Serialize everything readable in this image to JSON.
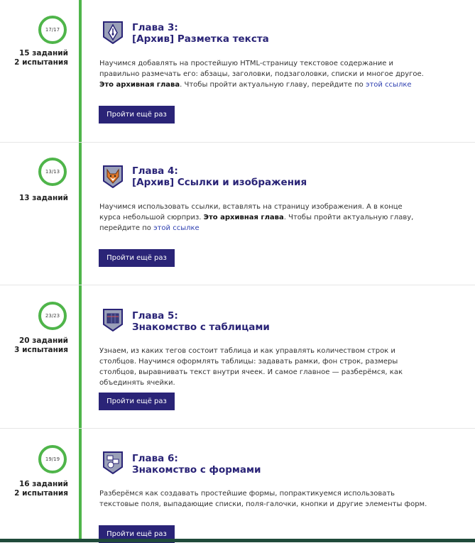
{
  "chapters": [
    {
      "progress": "17/17",
      "counts": [
        "15 заданий",
        "2 испытания"
      ],
      "title_line1": "Глава 3:",
      "title_line2": "[Архив] Разметка текста",
      "icon": "pen-nib-icon",
      "desc_text": "Научимся добавлять на простейшую HTML-страницу текстовое содержание и правильно размечать его: абзацы, заголовки, подзаголовки, списки и многое другое. ",
      "desc_bold": "Это архивная глава",
      "desc_after": ". Чтобы пройти актуальную главу, перейдите по ",
      "link": "этой ссылке",
      "button": "Пройти ещё раз"
    },
    {
      "progress": "13/13",
      "counts": [
        "13 заданий"
      ],
      "title_line1": "Глава 4:",
      "title_line2": "[Архив] Ссылки и изображения",
      "icon": "fox-icon",
      "desc_text": "Научимся использовать ссылки, вставлять на страницу изображения. А в конце курса небольшой сюрприз. ",
      "desc_bold": "Это архивная глава",
      "desc_after": ". Чтобы пройти актуальную главу, перейдите по ",
      "link": "этой ссылке",
      "button": "Пройти ещё раз"
    },
    {
      "progress": "23/23",
      "counts": [
        "20 заданий",
        "3 испытания"
      ],
      "title_line1": "Глава 5:",
      "title_line2": "Знакомство с таблицами",
      "icon": "table-icon",
      "desc_text": "Узнаем, из каких тегов состоит таблица и как управлять количеством строк и столбцов. Научимся оформлять таблицы: задавать рамки, фон строк, размеры столбцов, выравнивать текст внутри ячеек. И самое главное — разберёмся, как объединять ячейки.",
      "button": "Пройти ещё раз"
    },
    {
      "progress": "19/19",
      "counts": [
        "16 заданий",
        "2 испытания"
      ],
      "title_line1": "Глава 6:",
      "title_line2": "Знакомство с формами",
      "icon": "forms-icon",
      "desc_text": "Разберёмся как создавать простейшие формы, попрактикуемся использовать текстовые поля, выпадающие списки, поля-галочки, кнопки и другие элементы форм.",
      "button": "Пройти ещё раз"
    }
  ],
  "colors": {
    "accent_green": "#4fb54a",
    "brand_dark": "#2a2477",
    "link": "#2e3fb0"
  }
}
